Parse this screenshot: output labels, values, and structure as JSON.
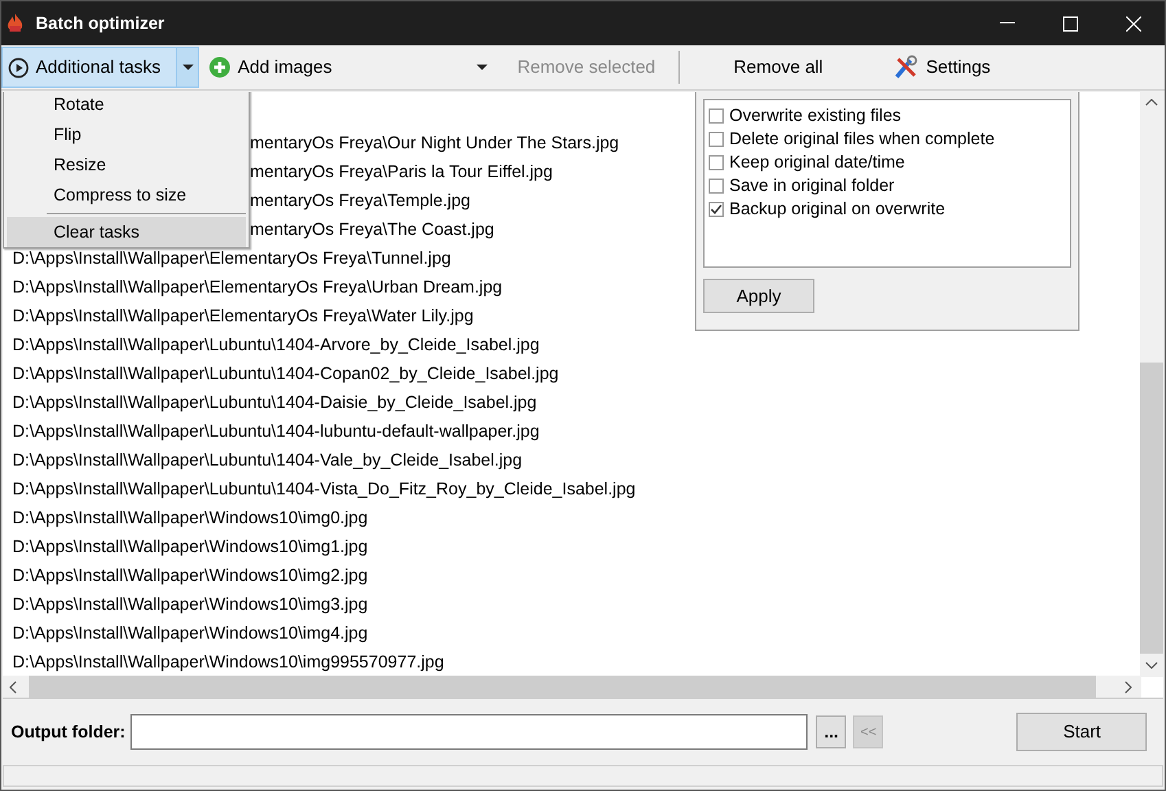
{
  "window": {
    "title": "Batch optimizer"
  },
  "toolbar": [
    {
      "kind": "split",
      "label": "Additional tasks",
      "selected": true,
      "disabled": false
    },
    {
      "kind": "split",
      "label": "Add images",
      "selected": false,
      "disabled": false
    },
    {
      "kind": "button",
      "label": "Remove selected",
      "selected": false,
      "disabled": true
    },
    {
      "kind": "separator"
    },
    {
      "kind": "button",
      "label": "Remove all",
      "selected": false,
      "disabled": false
    },
    {
      "kind": "button",
      "label": "Settings",
      "selected": false,
      "disabled": false
    }
  ],
  "menu": {
    "items": [
      {
        "label": "Rotate",
        "selected": false
      },
      {
        "label": "Flip",
        "selected": false
      },
      {
        "label": "Resize",
        "selected": false
      },
      {
        "label": "Compress to size",
        "selected": false
      },
      {
        "kind": "separator"
      },
      {
        "label": "Clear tasks",
        "selected": true
      }
    ]
  },
  "files": [
    {
      "path": "mentaryOs Freya\\Our Night Under The Stars.jpg",
      "partial": true
    },
    {
      "path": "mentaryOs Freya\\Paris la Tour Eiffel.jpg",
      "partial": true
    },
    {
      "path": "mentaryOs Freya\\Temple.jpg",
      "partial": true
    },
    {
      "path": "mentaryOs Freya\\The Coast.jpg",
      "partial": true
    },
    {
      "path": "D:\\Apps\\Install\\Wallpaper\\ElementaryOs Freya\\Tunnel.jpg",
      "partial": false
    },
    {
      "path": "D:\\Apps\\Install\\Wallpaper\\ElementaryOs Freya\\Urban Dream.jpg",
      "partial": false
    },
    {
      "path": "D:\\Apps\\Install\\Wallpaper\\ElementaryOs Freya\\Water Lily.jpg",
      "partial": false
    },
    {
      "path": "D:\\Apps\\Install\\Wallpaper\\Lubuntu\\1404-Arvore_by_Cleide_Isabel.jpg",
      "partial": false
    },
    {
      "path": "D:\\Apps\\Install\\Wallpaper\\Lubuntu\\1404-Copan02_by_Cleide_Isabel.jpg",
      "partial": false
    },
    {
      "path": "D:\\Apps\\Install\\Wallpaper\\Lubuntu\\1404-Daisie_by_Cleide_Isabel.jpg",
      "partial": false
    },
    {
      "path": "D:\\Apps\\Install\\Wallpaper\\Lubuntu\\1404-lubuntu-default-wallpaper.jpg",
      "partial": false
    },
    {
      "path": "D:\\Apps\\Install\\Wallpaper\\Lubuntu\\1404-Vale_by_Cleide_Isabel.jpg",
      "partial": false
    },
    {
      "path": "D:\\Apps\\Install\\Wallpaper\\Lubuntu\\1404-Vista_Do_Fitz_Roy_by_Cleide_Isabel.jpg",
      "partial": false
    },
    {
      "path": "D:\\Apps\\Install\\Wallpaper\\Windows10\\img0.jpg",
      "partial": false
    },
    {
      "path": "D:\\Apps\\Install\\Wallpaper\\Windows10\\img1.jpg",
      "partial": false
    },
    {
      "path": "D:\\Apps\\Install\\Wallpaper\\Windows10\\img2.jpg",
      "partial": false
    },
    {
      "path": "D:\\Apps\\Install\\Wallpaper\\Windows10\\img3.jpg",
      "partial": false
    },
    {
      "path": "D:\\Apps\\Install\\Wallpaper\\Windows10\\img4.jpg",
      "partial": false
    },
    {
      "path": "D:\\Apps\\Install\\Wallpaper\\Windows10\\img995570977.jpg",
      "partial": false
    }
  ],
  "options": {
    "items": [
      {
        "label": "Overwrite existing files",
        "checked": false
      },
      {
        "label": "Delete original files when complete",
        "checked": false
      },
      {
        "label": "Keep original date/time",
        "checked": false
      },
      {
        "label": "Save in original folder",
        "checked": false
      },
      {
        "label": "Backup original on overwrite",
        "checked": true
      }
    ],
    "apply": "Apply"
  },
  "output": {
    "label": "Output folder:",
    "browse": "...",
    "back": "<<",
    "back_disabled": true
  },
  "start": "Start"
}
